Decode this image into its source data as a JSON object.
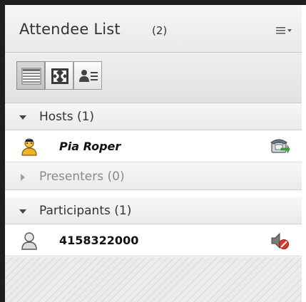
{
  "header": {
    "title": "Attendee List",
    "count": "(2)",
    "menu_icon": "menu-lines-icon"
  },
  "toolbar": {
    "buttons": [
      {
        "name": "list-view",
        "icon": "list-view-icon",
        "active": true
      },
      {
        "name": "fullscreen",
        "icon": "fullscreen-icon",
        "active": false
      },
      {
        "name": "attendee-details",
        "icon": "person-list-icon",
        "active": false
      }
    ]
  },
  "sections": {
    "hosts": {
      "label": "Hosts (1)",
      "expanded": true
    },
    "presenters": {
      "label": "Presenters (0)",
      "expanded": false
    },
    "participants": {
      "label": "Participants (1)",
      "expanded": true
    }
  },
  "attendees": {
    "host": {
      "name": "Pia Roper",
      "role": "host",
      "status_icon": "phone-connected-icon"
    },
    "participant": {
      "name": "4158322000",
      "role": "participant",
      "status_icon": "speaker-muted-icon"
    }
  },
  "colors": {
    "panel_border": "#1e1e1e",
    "header_bg": "#eeeeee",
    "text": "#333333",
    "muted_red": "#d83b2d",
    "phone_green": "#3fa63b"
  }
}
